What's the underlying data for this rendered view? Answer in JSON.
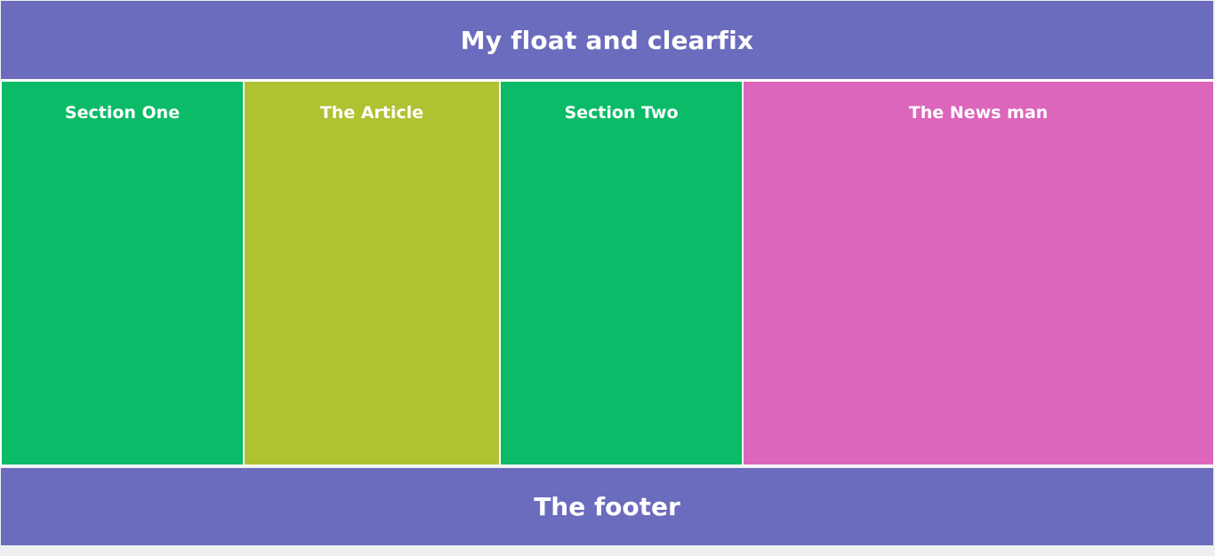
{
  "header": {
    "title": "My float and clearfix"
  },
  "columns": [
    {
      "label": "Section One",
      "color": "#0bbb67"
    },
    {
      "label": "The Article",
      "color": "#afc231"
    },
    {
      "label": "Section Two",
      "color": "#0bbb67"
    },
    {
      "label": "The News man",
      "color": "#dc66bb"
    }
  ],
  "footer": {
    "title": "The footer"
  },
  "colors": {
    "header_footer": "#6b6cbd",
    "text": "#ffffff",
    "background": "#efefef"
  }
}
